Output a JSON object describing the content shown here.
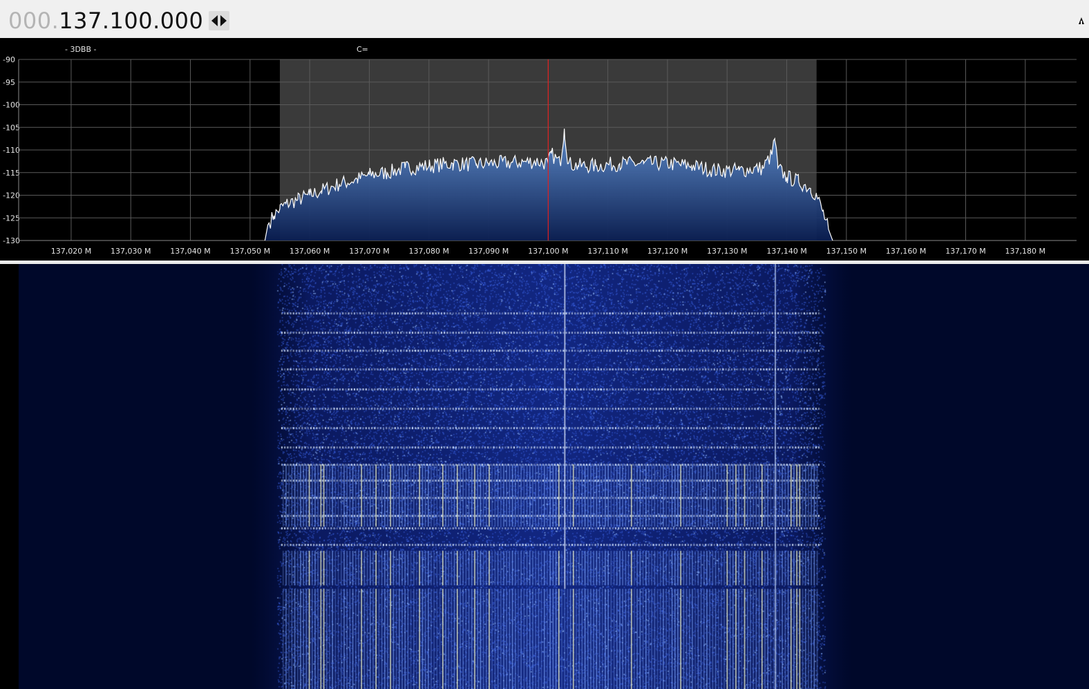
{
  "frequency": {
    "dim_prefix": "000.",
    "main": "137.100.000"
  },
  "spectrum": {
    "label_left": "- 3DBB -",
    "label_mid": "C="
  },
  "colors": {
    "grid": "#5a5a5a",
    "passband": "#3a3a3a",
    "center_line": "#e02020",
    "trace": "#ffffff",
    "fill_top": "#5f8fd0",
    "fill_bottom": "#0a1e52",
    "waterfall_bg": "#00082a"
  },
  "chart_data": {
    "type": "area",
    "title": "",
    "xlabel": "",
    "ylabel": "",
    "xlim": [
      137.0112,
      137.1886
    ],
    "ylim": [
      -130,
      -90
    ],
    "y_ticks": [
      -90,
      -95,
      -100,
      -105,
      -110,
      -115,
      -120,
      -125,
      -130
    ],
    "x_ticks": [
      137.02,
      137.03,
      137.04,
      137.05,
      137.06,
      137.07,
      137.08,
      137.09,
      137.1,
      137.11,
      137.12,
      137.13,
      137.14,
      137.15,
      137.16,
      137.17,
      137.18
    ],
    "x_tick_labels": [
      "137,020 M",
      "137,030 M",
      "137,040 M",
      "137,050 M",
      "137,060 M",
      "137,070 M",
      "137,080 M",
      "137,090 M",
      "137,100 M",
      "137,110 M",
      "137,120 M",
      "137,130 M",
      "137,140 M",
      "137,150 M",
      "137,160 M",
      "137,170 M",
      "137,180 M"
    ],
    "center_frequency": 137.1,
    "passband": [
      137.055,
      137.145
    ],
    "grid": true,
    "series": [
      {
        "x": [
          137.0525,
          137.053,
          137.054,
          137.055,
          137.056,
          137.058,
          137.06,
          137.062,
          137.065,
          137.068,
          137.07,
          137.073,
          137.076,
          137.08,
          137.084,
          137.088,
          137.09,
          137.094,
          137.098,
          137.1,
          137.1005,
          137.102,
          137.1027,
          137.1034,
          137.105,
          137.108,
          137.112,
          137.116,
          137.12,
          137.124,
          137.128,
          137.132,
          137.136,
          137.1375,
          137.138,
          137.1385,
          137.14,
          137.142,
          137.144,
          137.145,
          137.146,
          137.147,
          137.1477
        ],
        "values": [
          -130,
          -126.5,
          -124.5,
          -123,
          -122,
          -121,
          -120,
          -119,
          -117.5,
          -116.5,
          -115.5,
          -115,
          -114,
          -113.5,
          -113,
          -113.2,
          -113,
          -112.8,
          -112.5,
          -113,
          -110.8,
          -113,
          -105.3,
          -113,
          -113.5,
          -113.5,
          -113,
          -113,
          -113,
          -113.5,
          -114.5,
          -114.5,
          -114,
          -111,
          -107.5,
          -114,
          -116,
          -117,
          -118.5,
          -120,
          -123.5,
          -127.5,
          -130
        ]
      }
    ]
  }
}
